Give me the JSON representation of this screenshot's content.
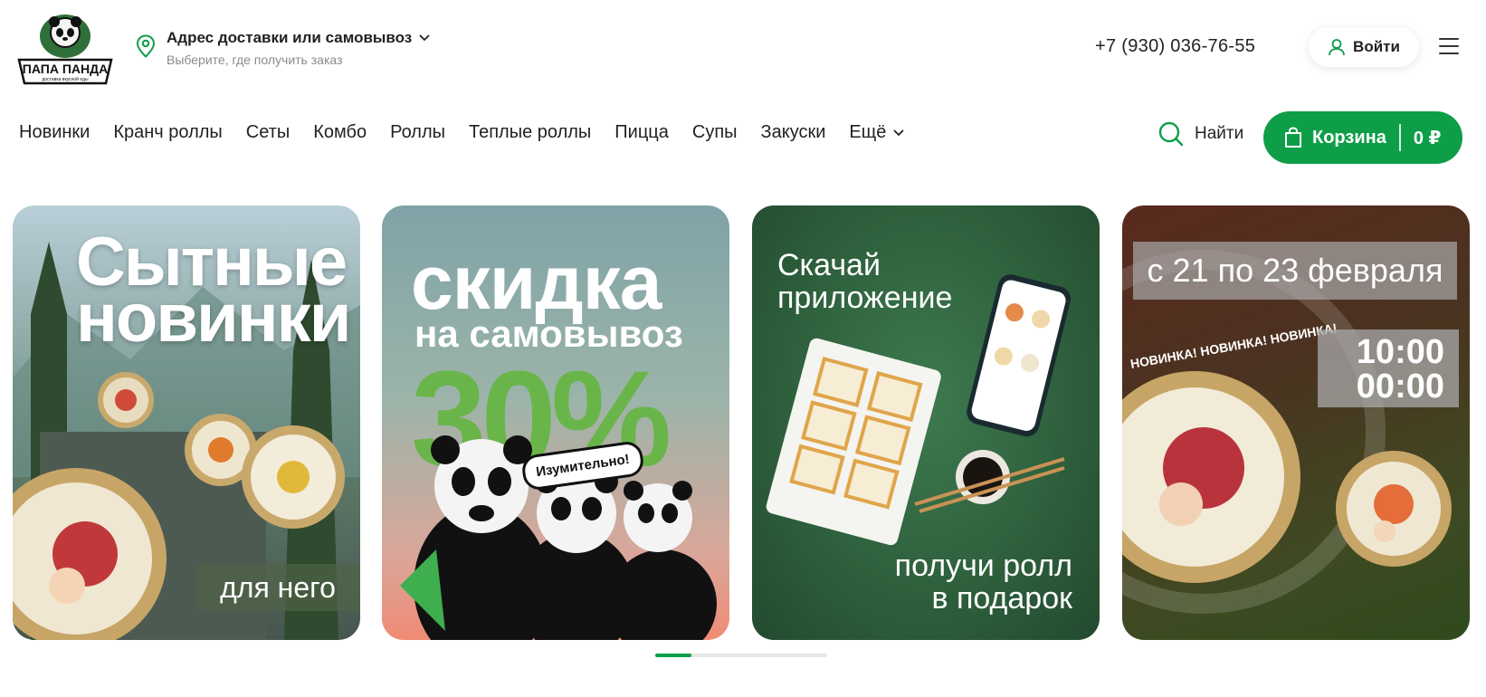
{
  "header": {
    "logo_text": "ПАПА ПАНДА",
    "logo_tagline": "доставка вкусной еды",
    "address_title": "Адрес доставки или самовывоз",
    "address_subtitle": "Выберите, где получить заказ",
    "phone": "+7 (930) 036-76-55",
    "login_label": "Войти"
  },
  "nav": {
    "items": [
      {
        "label": "Новинки"
      },
      {
        "label": "Кранч роллы"
      },
      {
        "label": "Сеты"
      },
      {
        "label": "Комбо"
      },
      {
        "label": "Роллы"
      },
      {
        "label": "Теплые роллы"
      },
      {
        "label": "Пицца"
      },
      {
        "label": "Супы"
      },
      {
        "label": "Закуски"
      },
      {
        "label": "Ещё"
      }
    ],
    "search_label": "Найти",
    "cart_label": "Корзина",
    "cart_total": "0 ₽"
  },
  "banners": [
    {
      "title_line1": "Сытные",
      "title_line2": "новинки",
      "subtitle": "для него"
    },
    {
      "title": "скидка",
      "subtitle": "на самовывоз",
      "percent": "30%",
      "bubble": "Изумительно!"
    },
    {
      "title_line1": "Скачай",
      "title_line2": "приложение",
      "subtitle_line1": "получи ролл",
      "subtitle_line2": "в подарок"
    },
    {
      "date": "с 21 по 23 февраля",
      "time_from": "10:00",
      "time_to": "00:00",
      "ring_text": "НОВИНКА! НОВИНКА! НОВИНКА!"
    }
  ],
  "colors": {
    "accent": "#0e9e48",
    "text": "#222222",
    "muted": "#8a8a8a"
  },
  "carousel": {
    "active_index": 0,
    "total": 4
  }
}
